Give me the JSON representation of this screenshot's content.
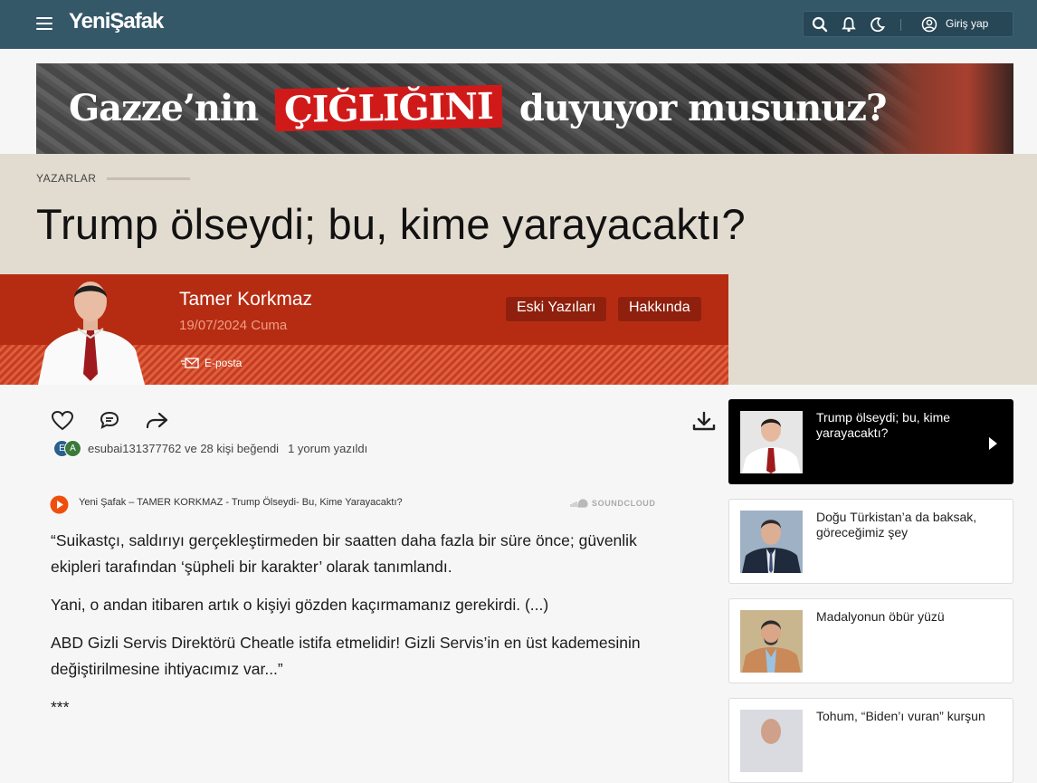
{
  "header": {
    "logo": "YeniŞafak",
    "login_label": "Giriş yap"
  },
  "banner": {
    "text_before": "Gazze’nin",
    "text_highlight": "ÇIĞLIĞINI",
    "text_after": "duyuyor musunuz?"
  },
  "section": {
    "label": "YAZARLAR"
  },
  "article": {
    "title": "Trump ölseydi; bu, kime yarayacaktı?",
    "author": "Tamer Korkmaz",
    "date": "19/07/2024 Cuma",
    "email_label": "E-posta",
    "old_posts_label": "Eski Yazıları",
    "about_label": "Hakkında",
    "likes_text": "esubai131377762 ve 28 kişi beğendi",
    "comments_text": "1 yorum yazıldı",
    "avatar_letters": [
      "E",
      "A"
    ],
    "player_title": "Yeni Şafak – TAMER KORKMAZ - Trump Ölseydi- Bu, Kime Yarayacaktı?",
    "player_brand": "SOUNDCLOUD",
    "paragraphs": [
      "“Suikastçı, saldırıyı gerçekleştirmeden bir saatten daha fazla bir süre önce; güvenlik ekipleri tarafından ‘şüpheli bir karakter’ olarak tanımlandı.",
      "Yani, o andan itibaren artık o kişiyi gözden kaçırmamanız gerekirdi. (...)",
      "ABD Gizli Servis Direktörü Cheatle istifa etmelidir! Gizli Servis’in en üst kademesinin değiştirilmesine ihtiyacımız var...”",
      "***"
    ]
  },
  "sidebar": {
    "items": [
      {
        "title": "Trump ölseydi; bu, kime yarayacaktı?",
        "active": true
      },
      {
        "title": "Doğu Türkistan’a da baksak, göreceğimiz şey",
        "active": false
      },
      {
        "title": "Madalyonun öbür yüzü",
        "active": false
      },
      {
        "title": "Tohum, “Biden’ı vuran” kurşun",
        "active": false
      }
    ]
  },
  "colors": {
    "topbar": "#355869",
    "author_band": "#b62c12",
    "header_band": "#e2dbd0",
    "accent_red": "#d01a1a"
  }
}
